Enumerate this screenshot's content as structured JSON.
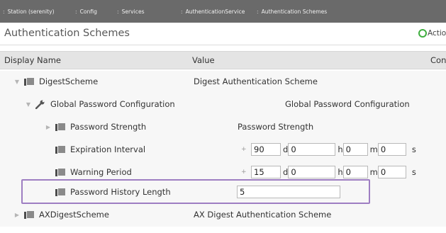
{
  "breadcrumb": {
    "items": [
      {
        "label": "Station (serenity)"
      },
      {
        "label": "Config"
      },
      {
        "label": "Services"
      },
      {
        "label": "AuthenticationService"
      },
      {
        "label": "Authentication Schemes"
      }
    ],
    "separator": ":"
  },
  "view": {
    "title": "Authentication Schemes",
    "actions_label": "Actio"
  },
  "table": {
    "columns": [
      "Display Name",
      "Value",
      "Con"
    ],
    "rows": [
      {
        "name": "DigestScheme",
        "value": "Digest Authentication Scheme",
        "expander": "expanded",
        "icon": "folder-icon"
      },
      {
        "name": "Global Password Configuration",
        "value": "Global Password Configuration",
        "expander": "expanded",
        "icon": "wrench-icon"
      },
      {
        "name": "Password Strength",
        "value": "Password Strength",
        "expander": "collapsed",
        "icon": "folder-icon"
      },
      {
        "name": "Expiration Interval",
        "icon": "folder-icon",
        "duration": {
          "days": "90",
          "days_unit": "d",
          "hours": "0",
          "hours_unit": "h",
          "minutes": "0",
          "minutes_unit": "m",
          "seconds": "0",
          "seconds_unit": "s",
          "sign": "+"
        }
      },
      {
        "name": "Warning Period",
        "icon": "folder-icon",
        "duration": {
          "days": "15",
          "days_unit": "d",
          "hours": "0",
          "hours_unit": "h",
          "minutes": "0",
          "minutes_unit": "m",
          "seconds": "0",
          "seconds_unit": "s",
          "sign": "+"
        }
      },
      {
        "name": "Password History Length",
        "value_input": "5",
        "icon": "folder-icon",
        "highlighted": true
      },
      {
        "name": "AXDigestScheme",
        "value": "AX Digest Authentication Scheme",
        "expander": "collapsed",
        "icon": "folder-icon"
      }
    ]
  },
  "colors": {
    "breadcrumb_bg": "#6a6a6a",
    "header_bg": "#e4e4e4",
    "row_bg": "#f7f7f7",
    "highlight_border": "#9e7ec2",
    "action_green": "#3fae3f"
  }
}
